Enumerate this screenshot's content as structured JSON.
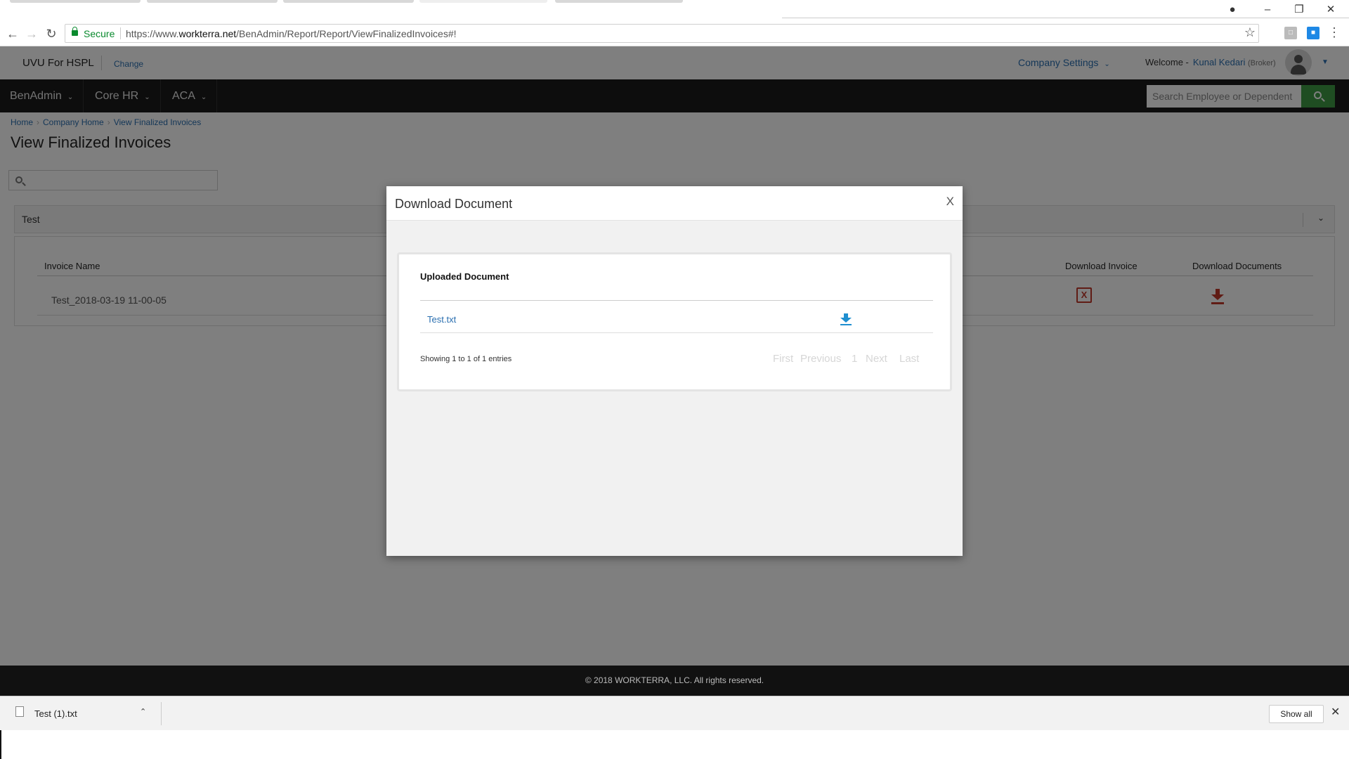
{
  "browser": {
    "secure_label": "Secure",
    "url_prefix": "https://www.",
    "url_domain": "workterra.net",
    "url_path": "/BenAdmin/Report/Report/ViewFinalizedInvoices#!",
    "icons": [
      "back-icon",
      "forward-icon",
      "reload-icon",
      "lock-icon",
      "star-icon",
      "menu-icon"
    ]
  },
  "header": {
    "company_name": "UVU For HSPL",
    "change_label": "Change",
    "company_settings_label": "Company Settings",
    "welcome_label": "Welcome -",
    "user_name": "Kunal Kedari",
    "user_role": "(Broker)"
  },
  "nav": {
    "items": [
      {
        "label": "BenAdmin"
      },
      {
        "label": "Core HR"
      },
      {
        "label": "ACA"
      }
    ],
    "search_placeholder": "Search Employee or Dependent",
    "accent_color": "#3f9b45"
  },
  "breadcrumb": [
    "Home",
    "Company Home",
    "View Finalized Invoices"
  ],
  "page_title": "View Finalized Invoices",
  "group": {
    "title": "Test",
    "columns": [
      "Invoice Name",
      "Download Invoice",
      "Download Documents"
    ],
    "rows": [
      {
        "invoice_name": "Test_2018-03-19 11-00-05"
      }
    ]
  },
  "modal": {
    "title": "Download Document",
    "close_label": "X",
    "table_heading": "Uploaded Document",
    "documents": [
      {
        "name": "Test.txt"
      }
    ],
    "info": "Showing 1 to 1 of 1 entries",
    "pager": {
      "first": "First",
      "previous": "Previous",
      "page": "1",
      "next": "Next",
      "last": "Last"
    }
  },
  "footer": {
    "copyright": "© 2018 WORKTERRA, LLC. All rights reserved."
  },
  "download_shelf": {
    "file_name": "Test (1).txt",
    "show_all_label": "Show all"
  }
}
